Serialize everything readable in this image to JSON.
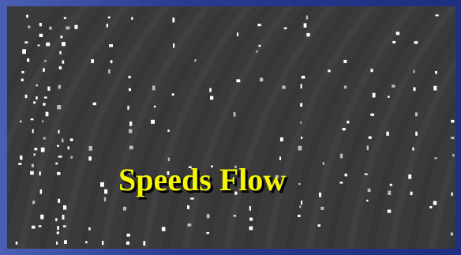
{
  "title": "Speeds Flow",
  "colors": {
    "background_blue": "#2f3e8c",
    "panel_gray": "#3a3a3c",
    "title_yellow": "#f5f500",
    "particle_white": "#ffffff"
  }
}
